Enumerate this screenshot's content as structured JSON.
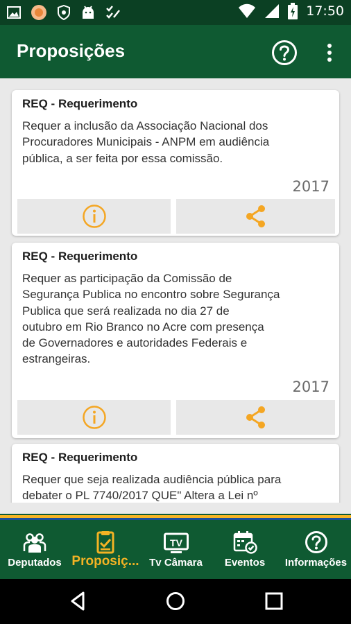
{
  "status_bar": {
    "time": "17:50",
    "icons": [
      "image-icon",
      "chrome-badge-icon",
      "shield-icon",
      "android-icon",
      "checklist-icon",
      "wifi-icon",
      "signal-icon",
      "battery-charging-icon"
    ]
  },
  "app_bar": {
    "title": "Proposições",
    "help_icon": "help-circle-icon",
    "menu_icon": "more-vert-icon"
  },
  "cards": [
    {
      "type": "REQ  - Requerimento",
      "lines": [
        "Requer a inclusão da Associação Nacional dos",
        "Procuradores Municipais - ANPM  em audiência",
        "pública, a ser feita por essa comissão."
      ],
      "year": "2017"
    },
    {
      "type": "REQ  - Requerimento",
      "lines": [
        "Requer as participação da Comissão de",
        "Segurança Publica no  encontro sobre Segurança",
        "Publica que será realizada no dia 27 de",
        "outubro em Rio Branco no Acre com presença",
        "de  Governadores e autoridades Federais e",
        "estrangeiras."
      ],
      "year": "2017"
    },
    {
      "type": "REQ  - Requerimento",
      "lines": [
        "Requer que seja realizada audiência pública para",
        "debater o PL 7740/2017 QUE\" Altera a Lei nº"
      ],
      "year": ""
    }
  ],
  "bottom_nav": [
    {
      "label": "Deputados",
      "icon": "people-icon",
      "active": false
    },
    {
      "label": "Proposiç...",
      "icon": "clipboard-check-icon",
      "active": true
    },
    {
      "label": "Tv Câmara",
      "icon": "tv-icon",
      "active": false
    },
    {
      "label": "Eventos",
      "icon": "calendar-check-icon",
      "active": false
    },
    {
      "label": "Informações",
      "icon": "help-circle-icon",
      "active": false
    }
  ],
  "colors": {
    "app_bar": "#0f5a32",
    "status_bar": "#0b4023",
    "accent": "#f4b324",
    "card_button": "#e8e8e8"
  }
}
